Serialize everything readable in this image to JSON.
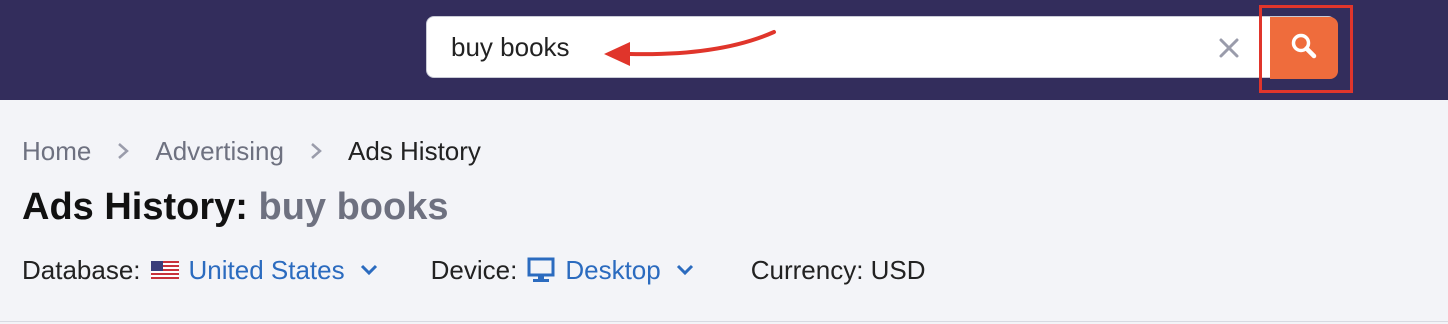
{
  "search": {
    "value": "buy books",
    "clear_icon": "close-icon",
    "button_icon": "search-icon",
    "button_color": "#ef6c3c"
  },
  "breadcrumb": {
    "items": [
      "Home",
      "Advertising",
      "Ads History"
    ]
  },
  "title": {
    "prefix": "Ads History:",
    "query": "buy books"
  },
  "filters": {
    "database_label": "Database:",
    "database_value": "United States",
    "device_label": "Device:",
    "device_value": "Desktop",
    "currency": "Currency: USD"
  },
  "colors": {
    "topbar": "#332d5c",
    "link": "#2b6bbf",
    "highlight": "#e0352b"
  }
}
